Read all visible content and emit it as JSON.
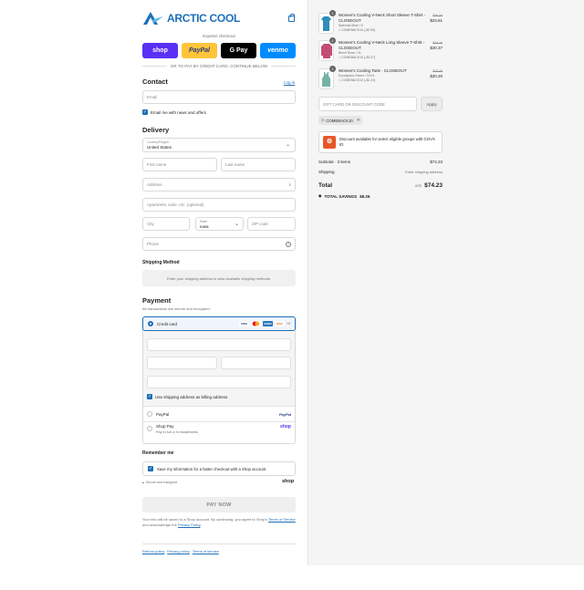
{
  "brand": {
    "name": "ARCTIC COOL",
    "accent": "#1d6fb8"
  },
  "express": {
    "title": "Express checkout",
    "buttons": [
      {
        "label": "shop",
        "bg": "#5a31f4",
        "fg": "#ffffff"
      },
      {
        "label": "PayPal",
        "bg": "#ffc439",
        "fg": "#253b80"
      },
      {
        "label": "G Pay",
        "bg": "#000000",
        "fg": "#ffffff"
      },
      {
        "label": "venmo",
        "bg": "#008cff",
        "fg": "#ffffff"
      }
    ],
    "divider": "OR TO PAY BY CREDIT CARD, CONTINUE BELOW"
  },
  "contact": {
    "title": "Contact",
    "login": "Log in",
    "email_placeholder": "Email",
    "news_label": "Email me with news and offers"
  },
  "delivery": {
    "title": "Delivery",
    "country_label": "Country/Region",
    "country_value": "United States",
    "first_name": "First name",
    "last_name": "Last name",
    "address": "Address",
    "apartment": "Apartment, suite, etc. (optional)",
    "city": "City",
    "state_label": "State",
    "state_value": "Iowa",
    "zip": "ZIP code",
    "phone": "Phone"
  },
  "shipping": {
    "title": "Shipping Method",
    "note": "Enter your shipping address to view available shipping methods."
  },
  "payment": {
    "title": "Payment",
    "subtitle": "All transactions are secure and encrypted.",
    "credit_card": "Credit card",
    "card_brands": [
      "VISA",
      "MC",
      "AMEX",
      "DISC",
      "+4"
    ],
    "billing_same": "Use shipping address as billing address",
    "paypal": "PayPal",
    "paypal_logo": "PayPal",
    "shop_pay": "Shop Pay",
    "shop_pay_sub": "Pay in full or in installments",
    "shop_logo": "shop"
  },
  "remember": {
    "title": "Remember me",
    "save_label": "Save my information for a faster checkout with a Shop account",
    "secure": "Secure and encrypted",
    "shop_logo": "shop"
  },
  "pay_now": "PAY NOW",
  "legal": {
    "text1": "Your info will be saved to a Shop account. By continuing, you agree to Shop's",
    "terms": "Terms of Service",
    "text2": "and acknowledge the",
    "privacy": "Privacy Policy",
    "end": "."
  },
  "footer_links": [
    "Refund policy",
    "Privacy policy",
    "Terms of service"
  ],
  "cart": {
    "items": [
      {
        "title": "Women's Cooling V-Neck Short Sleeve T-Shirt - CLOSEOUT",
        "variant": "Splendid Blue / S",
        "discount": "COMEBACK10 (-$2.65)",
        "qty": "1",
        "old_price": "$26.24",
        "price": "$23.61",
        "color": "#2e8fb8"
      },
      {
        "title": "Women's Cooling V-Neck Long Sleeve T-Shirt - CLOSEOUT",
        "variant": "Blush Rose / XL",
        "discount": "COMEBACK10 (-$3.37)",
        "qty": "1",
        "old_price": "$33.74",
        "price": "$30.37",
        "color": "#c24e74"
      },
      {
        "title": "Women's Cooling Tank - CLOSEOUT",
        "variant": "Eucalyptus Green / XXXL",
        "discount": "COMEBACK10 (-$2.24)",
        "qty": "1",
        "old_price": "$22.49",
        "price": "$20.25",
        "color": "#74b3a6"
      }
    ],
    "code_placeholder": "GIFT CARD OR DISCOUNT CODE",
    "apply": "Apply",
    "applied_code": "COMEBACK10",
    "govx": "Discount available for select eligible groups with GOVX ID",
    "subtotal_label": "Subtotal · 3 items",
    "subtotal": "$74.23",
    "shipping_label": "Shipping",
    "shipping_value": "Enter shipping address",
    "total_label": "Total",
    "currency": "USD",
    "total": "$74.23",
    "savings_label": "TOTAL SAVINGS",
    "savings": "$8.26"
  }
}
